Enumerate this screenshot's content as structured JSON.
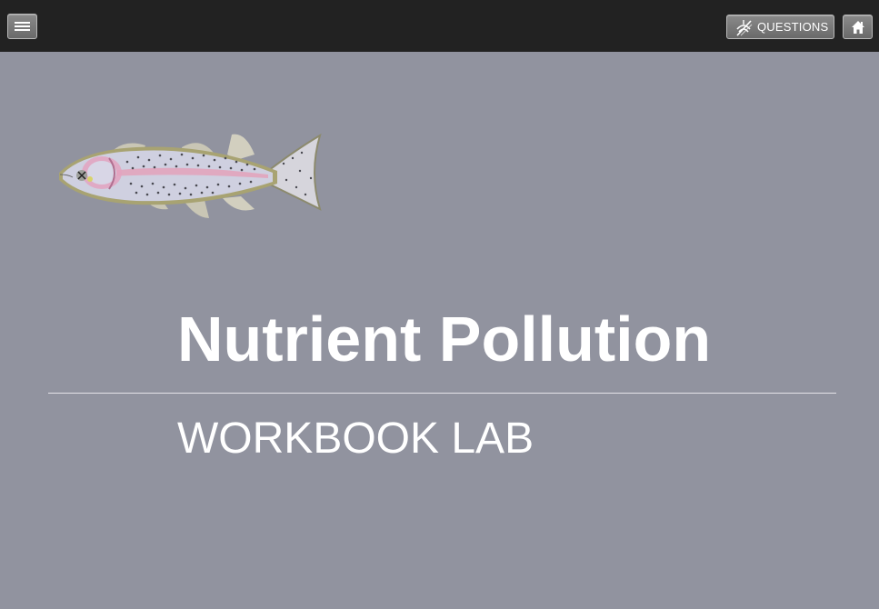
{
  "header": {
    "menu_icon": "hamburger-icon",
    "questions_label": "QUESTIONS",
    "questions_icon": "questions-off-icon",
    "home_icon": "home-icon"
  },
  "main": {
    "illustration": "trout-fish",
    "title": "Nutrient Pollution",
    "subtitle": "WORKBOOK LAB"
  },
  "colors": {
    "topbar": "#222222",
    "background": "#91939f",
    "text": "#ffffff"
  }
}
